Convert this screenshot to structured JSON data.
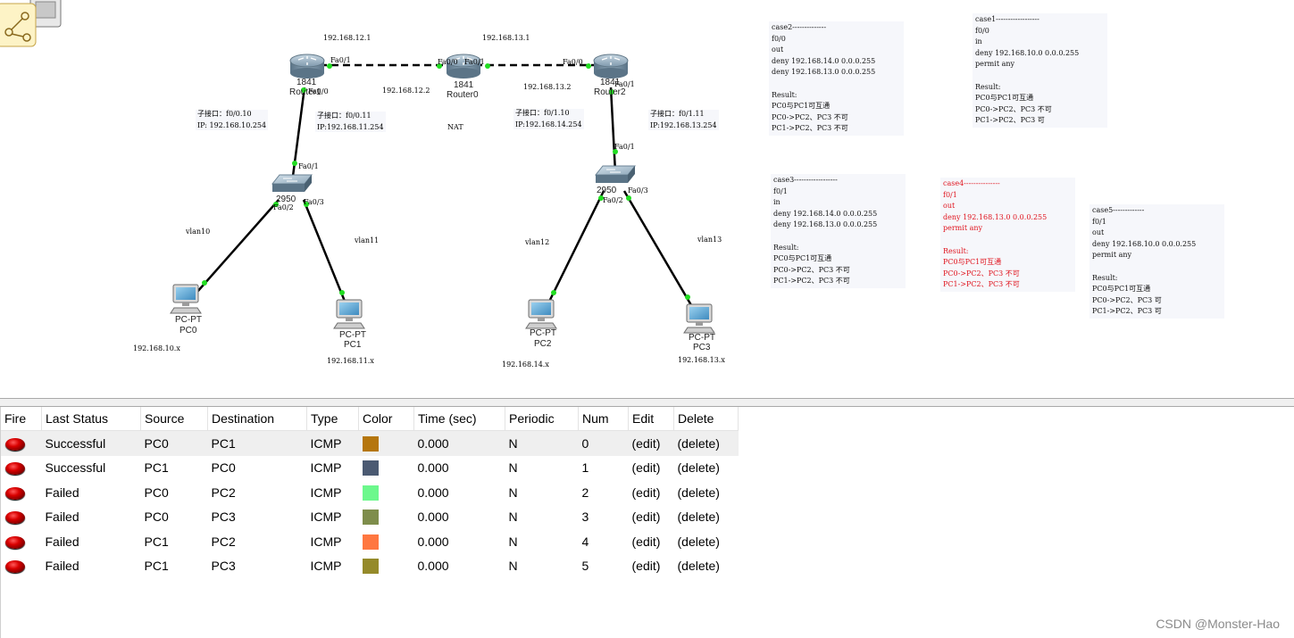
{
  "topology": {
    "routers": [
      {
        "model": "1841",
        "name": "Router1",
        "label_top": "1841",
        "label_bottom": "Router1"
      },
      {
        "model": "1841",
        "name": "Router0",
        "label_top": "1841",
        "label_bottom": "Router0"
      },
      {
        "model": "1841",
        "name": "Router2",
        "label_top": "1841",
        "label_bottom": "Router2"
      }
    ],
    "switches": [
      {
        "model": "2950-24",
        "name": "Switch0",
        "label": "2950"
      },
      {
        "model": "2950-24",
        "name": "Switch1",
        "label": "2950"
      }
    ],
    "pcs": [
      {
        "type": "PC-PT",
        "name": "PC0",
        "subnet": "192.168.10.x"
      },
      {
        "type": "PC-PT",
        "name": "PC1",
        "subnet": "192.168.11.x"
      },
      {
        "type": "PC-PT",
        "name": "PC2",
        "subnet": "192.168.14.x"
      },
      {
        "type": "PC-PT",
        "name": "PC3",
        "subnet": "192.168.13.x"
      }
    ],
    "ip_labels": {
      "r1_r0_net": "192.168.12.1",
      "r0_r2_net": "192.168.13.1",
      "r0_left": "192.168.12.2",
      "r0_right": "192.168.13.2",
      "nat": "NAT"
    },
    "ports": {
      "r1_fa01": "Fa0/1",
      "r1_fa00": "Fa0/0",
      "r0_fa00": "Fa0/0",
      "r0_fa01": "Fa0/1",
      "r2_fa00": "Fa0/0",
      "r2_fa01": "Fa0/1",
      "sw0_fa01": "Fa0/1",
      "sw0_fa02": "Fa0/2",
      "sw0_fa03": "Fa0/3",
      "sw1_fa01": "Fa0/1",
      "sw1_fa02": "Fa0/2",
      "sw1_fa03": "Fa0/3"
    },
    "subifs": {
      "s1_title": "子接口：f0/0.10",
      "s1_ip": "IP: 192.168.10.254",
      "s2_title": "子接口：f0/0.11",
      "s2_ip": "IP:192.168.11.254",
      "s3_title": "子接口：f0/1.10",
      "s3_ip": "IP:192.168.14.254",
      "s4_title": "子接口：f0/1.11",
      "s4_ip": "IP:192.168.13.254"
    },
    "vlans": {
      "v10": "vlan10",
      "v11": "vlan11",
      "v12": "vlan12",
      "v13": "vlan13"
    }
  },
  "notes": {
    "case2": [
      "case2--------------",
      "f0/0",
      "out",
      "deny 192.168.14.0 0.0.0.255",
      "deny 192.168.13.0 0.0.0.255",
      "",
      "Result:",
      "PC0与PC1可互通",
      "PC0->PC2、PC3  不可",
      "PC1->PC2、PC3  不可"
    ],
    "case1": [
      "case1------------------",
      "f0/0",
      "in",
      "deny 192.168.10.0 0.0.0.255",
      "permit any",
      "",
      "Result:",
      "PC0与PC1可互通",
      "PC0->PC2、PC3  不可",
      "PC1->PC2、PC3  可"
    ],
    "case3": [
      "case3------------------",
      "f0/1",
      "in",
      "deny 192.168.14.0 0.0.0.255",
      "deny 192.168.13.0 0.0.0.255",
      "",
      "Result:",
      "PC0与PC1可互通",
      "PC0->PC2、PC3  不可",
      "PC1->PC2、PC3  不可"
    ],
    "case4": [
      "case4---------------",
      "f0/1",
      "out",
      "deny 192.168.13.0 0.0.0.255",
      "permit any",
      "",
      "Result:",
      "PC0与PC1可互通",
      "PC0->PC2、PC3  不可",
      "PC1->PC2、PC3  不可"
    ],
    "case5": [
      "case5-------------",
      "f0/1",
      "out",
      "deny 192.168.10.0 0.0.0.255",
      "permit any",
      "",
      "Result:",
      "PC0与PC1可互通",
      "PC0->PC2、PC3  可",
      "PC1->PC2、PC3  可"
    ]
  },
  "pdu_table": {
    "headers": [
      "Fire",
      "Last Status",
      "Source",
      "Destination",
      "Type",
      "Color",
      "Time (sec)",
      "Periodic",
      "Num",
      "Edit",
      "Delete"
    ],
    "rows": [
      {
        "status": "Successful",
        "source": "PC0",
        "destination": "PC1",
        "type": "ICMP",
        "color": "#b5760d",
        "time": "0.000",
        "periodic": "N",
        "num": "0",
        "edit": "(edit)",
        "delete": "(delete)"
      },
      {
        "status": "Successful",
        "source": "PC1",
        "destination": "PC0",
        "type": "ICMP",
        "color": "#4b5a72",
        "time": "0.000",
        "periodic": "N",
        "num": "1",
        "edit": "(edit)",
        "delete": "(delete)"
      },
      {
        "status": "Failed",
        "source": "PC0",
        "destination": "PC2",
        "type": "ICMP",
        "color": "#6cf88c",
        "time": "0.000",
        "periodic": "N",
        "num": "2",
        "edit": "(edit)",
        "delete": "(delete)"
      },
      {
        "status": "Failed",
        "source": "PC0",
        "destination": "PC3",
        "type": "ICMP",
        "color": "#7e8d4b",
        "time": "0.000",
        "periodic": "N",
        "num": "3",
        "edit": "(edit)",
        "delete": "(delete)"
      },
      {
        "status": "Failed",
        "source": "PC1",
        "destination": "PC2",
        "type": "ICMP",
        "color": "#ff7740",
        "time": "0.000",
        "periodic": "N",
        "num": "4",
        "edit": "(edit)",
        "delete": "(delete)"
      },
      {
        "status": "Failed",
        "source": "PC1",
        "destination": "PC3",
        "type": "ICMP",
        "color": "#958a2a",
        "time": "0.000",
        "periodic": "N",
        "num": "5",
        "edit": "(edit)",
        "delete": "(delete)"
      }
    ]
  },
  "watermark": "CSDN @Monster-Hao",
  "colors": {
    "link_green": "#22dd22",
    "fire_red": "#d90000"
  },
  "icons": {
    "corner": "cluster-icon",
    "router": "router-icon",
    "switch": "switch-icon",
    "pc": "pc-icon"
  }
}
